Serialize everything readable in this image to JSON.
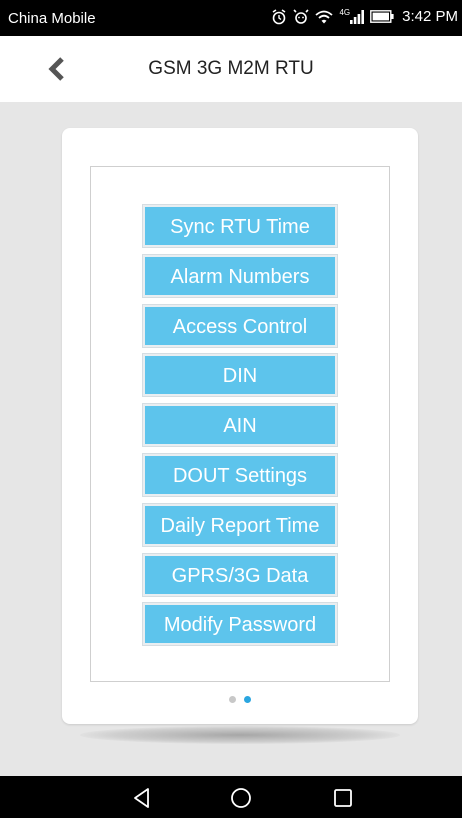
{
  "status_bar": {
    "carrier": "China Mobile",
    "network": "4G",
    "time": "3:42 PM",
    "icons": [
      "alarm-icon",
      "vibrate-icon",
      "wifi-icon",
      "signal-icon",
      "battery-icon"
    ]
  },
  "app_bar": {
    "title": "GSM 3G M2M RTU",
    "back_icon": "chevron-left-icon"
  },
  "menu": {
    "items": [
      {
        "label": "Sync RTU Time"
      },
      {
        "label": "Alarm Numbers"
      },
      {
        "label": "Access Control"
      },
      {
        "label": "DIN"
      },
      {
        "label": "AIN"
      },
      {
        "label": "DOUT Settings"
      },
      {
        "label": "Daily Report Time"
      },
      {
        "label": "GPRS/3G Data"
      },
      {
        "label": "Modify Password"
      }
    ]
  },
  "pager": {
    "pages": 2,
    "current": 2
  },
  "nav_bar": {
    "icons": [
      "back-triangle-icon",
      "home-circle-icon",
      "recent-square-icon"
    ]
  },
  "colors": {
    "button": "#5dc4ec",
    "page_dot_active": "#2aa6e0",
    "page_dot_inactive": "#c8c8c8",
    "background": "#e6e6e6"
  }
}
